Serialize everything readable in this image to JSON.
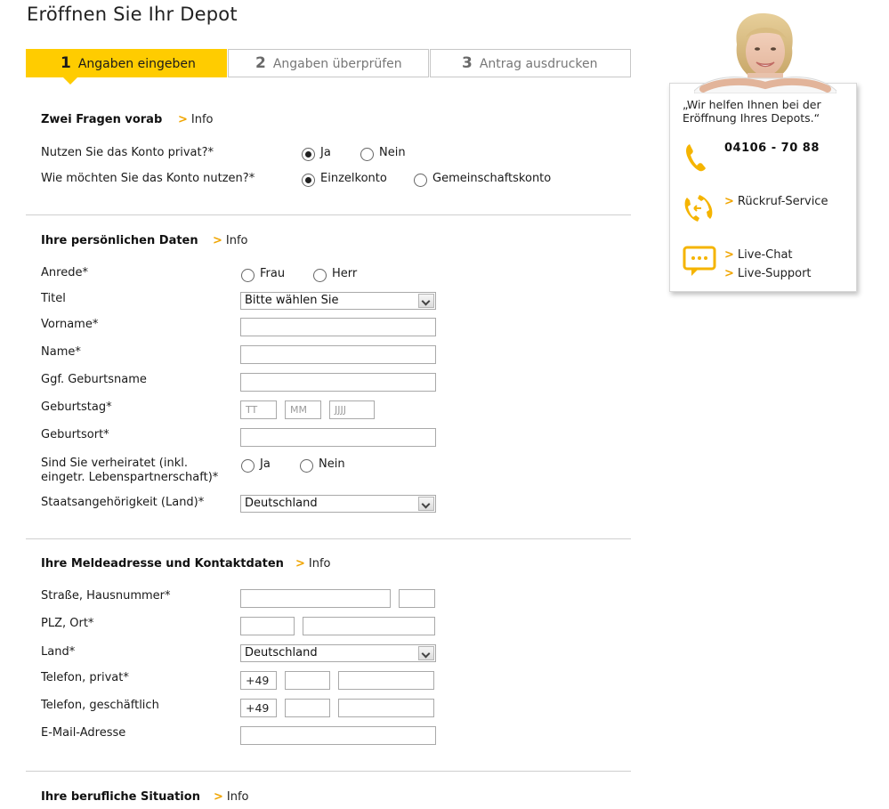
{
  "page": {
    "title": "Eröffnen Sie Ihr Depot"
  },
  "steps": [
    {
      "num": "1",
      "label": "Angaben eingeben",
      "active": true
    },
    {
      "num": "2",
      "label": "Angaben überprüfen",
      "active": false
    },
    {
      "num": "3",
      "label": "Antrag ausdrucken",
      "active": false
    }
  ],
  "info_label": "Info",
  "sections": {
    "fragen": {
      "title": "Zwei Fragen vorab",
      "privat": {
        "label": "Nutzen Sie das Konto privat?*",
        "options": [
          "Ja",
          "Nein"
        ],
        "selected": "Ja"
      },
      "nutzung": {
        "label": "Wie möchten Sie das Konto nutzen?*",
        "options": [
          "Einzelkonto",
          "Gemeinschaftskonto"
        ],
        "selected": "Einzelkonto"
      }
    },
    "persoenlich": {
      "title": "Ihre persönlichen Daten",
      "anrede": {
        "label": "Anrede*",
        "options": [
          "Frau",
          "Herr"
        ]
      },
      "titel": {
        "label": "Titel",
        "value": "Bitte wählen Sie"
      },
      "vorname": {
        "label": "Vorname*",
        "value": ""
      },
      "name": {
        "label": "Name*",
        "value": ""
      },
      "geburtsname": {
        "label": "Ggf. Geburtsname",
        "value": ""
      },
      "geburtstag": {
        "label": "Geburtstag*",
        "tt": "TT",
        "mm": "MM",
        "jjjj": "JJJJ"
      },
      "geburtsort": {
        "label": "Geburtsort*",
        "value": ""
      },
      "verheiratet": {
        "label_line1": "Sind Sie verheiratet (inkl.",
        "label_line2": "eingetr. Lebenspartnerschaft)*",
        "options": [
          "Ja",
          "Nein"
        ]
      },
      "staat": {
        "label": "Staatsangehörigkeit (Land)*",
        "value": "Deutschland"
      }
    },
    "adresse": {
      "title": "Ihre Meldeadresse und Kontaktdaten",
      "strasse": {
        "label": "Straße, Hausnummer*"
      },
      "plz": {
        "label": "PLZ, Ort*"
      },
      "land": {
        "label": "Land*",
        "value": "Deutschland"
      },
      "tel_privat": {
        "label": "Telefon, privat*",
        "prefix": "+49"
      },
      "tel_geschaeft": {
        "label": "Telefon, geschäftlich",
        "prefix": "+49"
      },
      "email": {
        "label": "E-Mail-Adresse"
      }
    },
    "beruf": {
      "title": "Ihre berufliche Situation"
    }
  },
  "support": {
    "quote_line1": "„Wir helfen Ihnen bei der",
    "quote_line2": "Eröffnung Ihres Depots.“",
    "phone": "04106 - 70 88",
    "callback": "Rückruf-Service",
    "chat": "Live-Chat",
    "live_support": "Live-Support"
  },
  "colors": {
    "accent": "#ffcc00",
    "chevron": "#f0a500",
    "icon": "#f5b400"
  }
}
